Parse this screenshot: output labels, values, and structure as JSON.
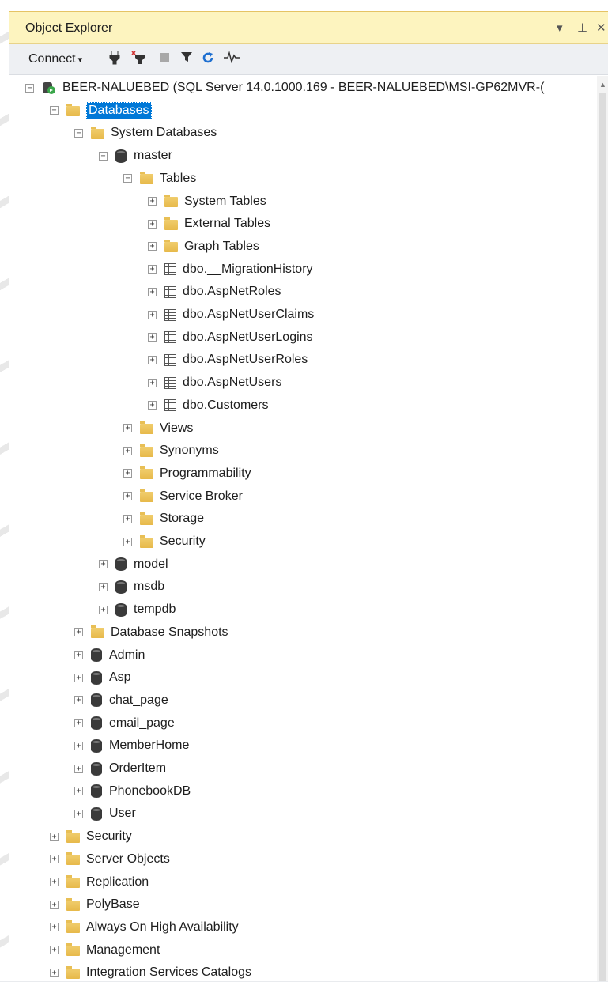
{
  "panel": {
    "title": "Object Explorer",
    "controls": {
      "dropdown_icon": "▾",
      "pin_icon": "⊥",
      "close_icon": "✕"
    }
  },
  "toolbar": {
    "connect_label": "Connect",
    "icons": [
      "connect-icon",
      "disconnect-icon",
      "stop-icon",
      "filter-icon",
      "refresh-icon",
      "activity-monitor-icon"
    ]
  },
  "tree": [
    {
      "label": "BEER-NALUEBED (SQL Server 14.0.1000.169 - BEER-NALUEBED\\MSI-GP62MVR-(",
      "icon": "server",
      "exp": "−",
      "level": 0
    },
    {
      "label": "Databases",
      "icon": "folder",
      "exp": "−",
      "level": 1,
      "selected": true
    },
    {
      "label": "System Databases",
      "icon": "folder",
      "exp": "−",
      "level": 2
    },
    {
      "label": "master",
      "icon": "db",
      "exp": "−",
      "level": 3
    },
    {
      "label": "Tables",
      "icon": "folder",
      "exp": "−",
      "level": 4
    },
    {
      "label": "System Tables",
      "icon": "folder",
      "exp": "+",
      "level": 5
    },
    {
      "label": "External Tables",
      "icon": "folder",
      "exp": "+",
      "level": 5
    },
    {
      "label": "Graph Tables",
      "icon": "folder",
      "exp": "+",
      "level": 5
    },
    {
      "label": "dbo.__MigrationHistory",
      "icon": "table",
      "exp": "+",
      "level": 5
    },
    {
      "label": "dbo.AspNetRoles",
      "icon": "table",
      "exp": "+",
      "level": 5
    },
    {
      "label": "dbo.AspNetUserClaims",
      "icon": "table",
      "exp": "+",
      "level": 5
    },
    {
      "label": "dbo.AspNetUserLogins",
      "icon": "table",
      "exp": "+",
      "level": 5
    },
    {
      "label": "dbo.AspNetUserRoles",
      "icon": "table",
      "exp": "+",
      "level": 5
    },
    {
      "label": "dbo.AspNetUsers",
      "icon": "table",
      "exp": "+",
      "level": 5
    },
    {
      "label": "dbo.Customers",
      "icon": "table",
      "exp": "+",
      "level": 5
    },
    {
      "label": "Views",
      "icon": "folder",
      "exp": "+",
      "level": 4
    },
    {
      "label": "Synonyms",
      "icon": "folder",
      "exp": "+",
      "level": 4
    },
    {
      "label": "Programmability",
      "icon": "folder",
      "exp": "+",
      "level": 4
    },
    {
      "label": "Service Broker",
      "icon": "folder",
      "exp": "+",
      "level": 4
    },
    {
      "label": "Storage",
      "icon": "folder",
      "exp": "+",
      "level": 4
    },
    {
      "label": "Security",
      "icon": "folder",
      "exp": "+",
      "level": 4
    },
    {
      "label": "model",
      "icon": "db",
      "exp": "+",
      "level": 3
    },
    {
      "label": "msdb",
      "icon": "db",
      "exp": "+",
      "level": 3
    },
    {
      "label": "tempdb",
      "icon": "db",
      "exp": "+",
      "level": 3
    },
    {
      "label": "Database Snapshots",
      "icon": "folder",
      "exp": "+",
      "level": 2
    },
    {
      "label": "Admin",
      "icon": "db",
      "exp": "+",
      "level": 2
    },
    {
      "label": "Asp",
      "icon": "db",
      "exp": "+",
      "level": 2
    },
    {
      "label": "chat_page",
      "icon": "db",
      "exp": "+",
      "level": 2
    },
    {
      "label": "email_page",
      "icon": "db",
      "exp": "+",
      "level": 2
    },
    {
      "label": "MemberHome",
      "icon": "db",
      "exp": "+",
      "level": 2
    },
    {
      "label": "OrderItem",
      "icon": "db",
      "exp": "+",
      "level": 2
    },
    {
      "label": "PhonebookDB",
      "icon": "db",
      "exp": "+",
      "level": 2
    },
    {
      "label": "User",
      "icon": "db",
      "exp": "+",
      "level": 2
    },
    {
      "label": "Security",
      "icon": "folder",
      "exp": "+",
      "level": 1
    },
    {
      "label": "Server Objects",
      "icon": "folder",
      "exp": "+",
      "level": 1
    },
    {
      "label": "Replication",
      "icon": "folder",
      "exp": "+",
      "level": 1
    },
    {
      "label": "PolyBase",
      "icon": "folder",
      "exp": "+",
      "level": 1
    },
    {
      "label": "Always On High Availability",
      "icon": "folder",
      "exp": "+",
      "level": 1
    },
    {
      "label": "Management",
      "icon": "folder",
      "exp": "+",
      "level": 1
    },
    {
      "label": "Integration Services Catalogs",
      "icon": "folder",
      "exp": "+",
      "level": 1
    }
  ],
  "colors": {
    "selection": "#0078d7",
    "title_bg": "#fdf4bf",
    "folder": "#e7b94a",
    "server_badge": "#3aa64a"
  }
}
